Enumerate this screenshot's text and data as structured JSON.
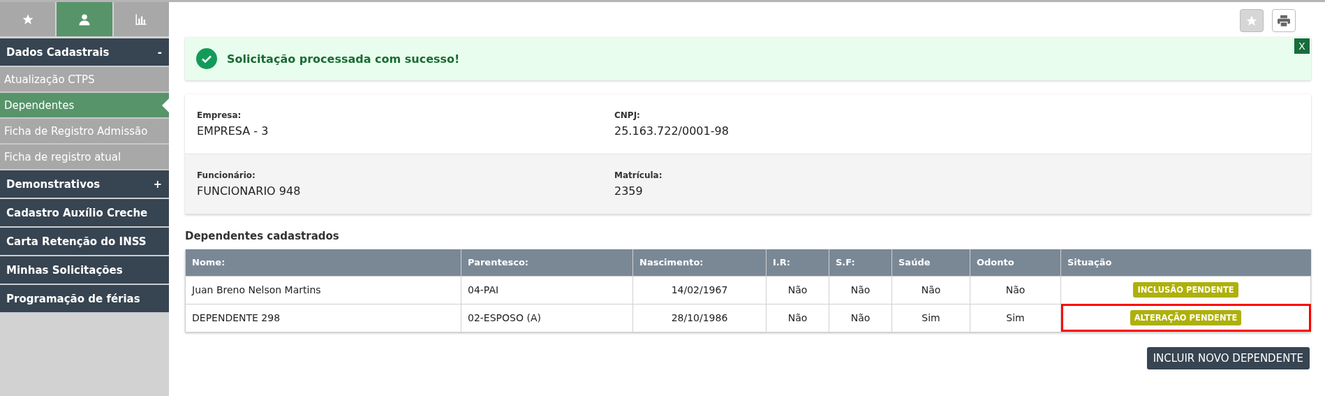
{
  "sidebar": {
    "tabs": [
      {
        "selected": false
      },
      {
        "selected": true
      },
      {
        "selected": false
      }
    ],
    "menu": [
      {
        "label": "Dados Cadastrais",
        "toggle": "-",
        "children": [
          {
            "label": "Atualização CTPS",
            "selected": false
          },
          {
            "label": "Dependentes",
            "selected": true
          },
          {
            "label": "Ficha de Registro Admissão",
            "selected": false
          },
          {
            "label": "Ficha de registro atual",
            "selected": false
          }
        ]
      },
      {
        "label": "Demonstrativos",
        "toggle": "+"
      },
      {
        "label": "Cadastro Auxílio Creche"
      },
      {
        "label": "Carta Retenção do INSS"
      },
      {
        "label": "Minhas Solicitações"
      },
      {
        "label": "Programação de férias"
      }
    ]
  },
  "toolbar": {
    "favorite_active": false
  },
  "alert": {
    "message": "Solicitação processada com sucesso!",
    "close": "X"
  },
  "info": [
    [
      {
        "label": "Empresa:",
        "value": "EMPRESA - 3"
      },
      {
        "label": "CNPJ:",
        "value": "25.163.722/0001-98"
      }
    ],
    [
      {
        "label": "Funcionário:",
        "value": "FUNCIONARIO 948"
      },
      {
        "label": "Matrícula:",
        "value": "2359"
      }
    ]
  ],
  "section_title": "Dependentes cadastrados",
  "table": {
    "columns": [
      "Nome:",
      "Parentesco:",
      "Nascimento:",
      "I.R:",
      "S.F:",
      "Saúde",
      "Odonto",
      "Situação"
    ],
    "rows": [
      {
        "cells": [
          "Juan Breno Nelson Martins",
          "04-PAI",
          "14/02/1967",
          "Não",
          "Não",
          "Não",
          "Não"
        ],
        "status": "INCLUSÃO PENDENTE",
        "highlighted": false
      },
      {
        "cells": [
          "DEPENDENTE 298",
          "02-ESPOSO (A)",
          "28/10/1986",
          "Não",
          "Não",
          "Sim",
          "Sim"
        ],
        "status": "ALTERAÇÃO PENDENTE",
        "highlighted": true
      }
    ]
  },
  "add_button": "INCLUIR NOVO DEPENDENTE"
}
